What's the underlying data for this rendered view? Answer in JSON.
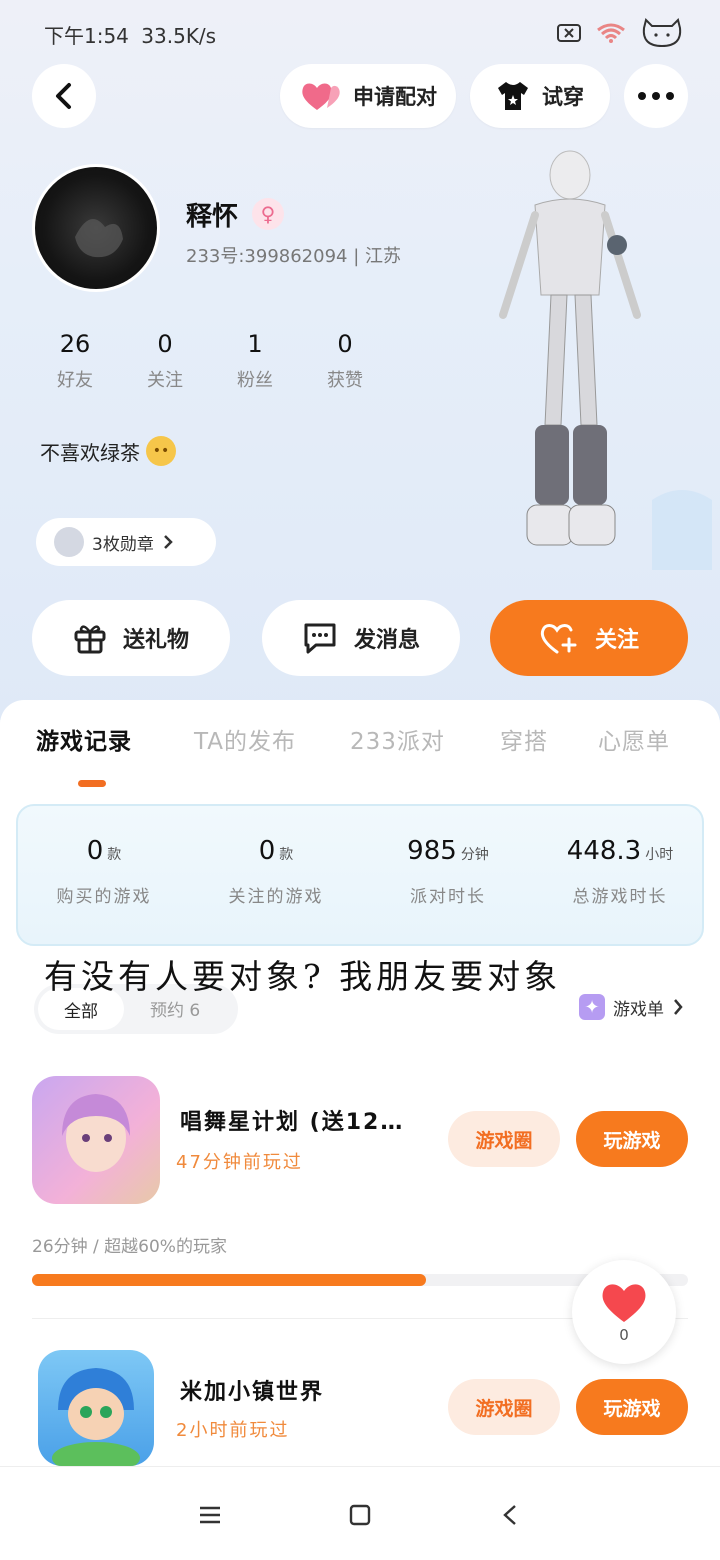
{
  "status_bar": {
    "time": "下午1:54",
    "speed": "33.5K/s"
  },
  "header": {
    "pair_label": "申请配对",
    "try_label": "试穿"
  },
  "profile": {
    "name": "释怀",
    "gender_symbol": "♀",
    "id_line": "233号:399862094 | 江苏",
    "bio": "不喜欢绿茶",
    "badges_label": "3枚勋章",
    "stats": [
      {
        "value": "26",
        "label": "好友"
      },
      {
        "value": "0",
        "label": "关注"
      },
      {
        "value": "1",
        "label": "粉丝"
      },
      {
        "value": "0",
        "label": "获赞"
      }
    ]
  },
  "actions": {
    "gift": "送礼物",
    "message": "发消息",
    "follow": "关注"
  },
  "tabs": [
    "游戏记录",
    "TA的发布",
    "233派对",
    "穿搭",
    "心愿单"
  ],
  "summary": [
    {
      "value": "0",
      "unit": "款",
      "label": "购买的游戏"
    },
    {
      "value": "0",
      "unit": "款",
      "label": "关注的游戏"
    },
    {
      "value": "985",
      "unit": "分钟",
      "label": "派对时长"
    },
    {
      "value": "448.3",
      "unit": "小时",
      "label": "总游戏时长"
    }
  ],
  "overlay_text": "有没有人要对象? 我朋友要对象",
  "filter": {
    "all": "全部",
    "reserved": "预约 6",
    "game_list": "游戏单"
  },
  "games": [
    {
      "name": "唱舞星计划 (送12…",
      "last_played": "47分钟前玩过",
      "circle_label": "游戏圈",
      "play_label": "玩游戏"
    },
    {
      "name": "米加小镇世界",
      "last_played": "2小时前玩过",
      "circle_label": "游戏圈",
      "play_label": "玩游戏"
    }
  ],
  "progress": {
    "text": "26分钟 / 超越60%的玩家",
    "fraction": 0.6
  },
  "like": {
    "count": "0"
  },
  "colors": {
    "accent": "#f77a1e",
    "pink": "#ec6b8f"
  }
}
